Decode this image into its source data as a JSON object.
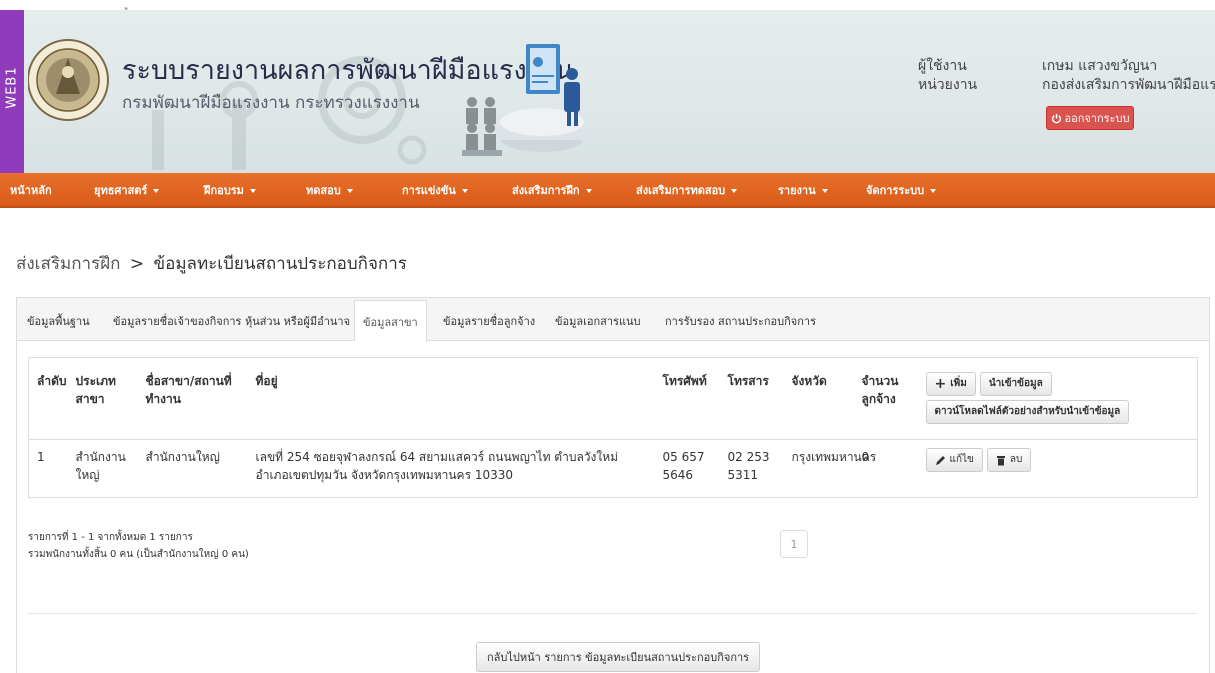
{
  "top_mark": "ู",
  "env_label": "WEB1",
  "header": {
    "title": "ระบบรายงานผลการพัฒนาฝีมือแรงงาน",
    "subtitle": "กรมพัฒนาฝีมือแรงงาน กระทรวงแรงงาน",
    "user_label": "ผู้ใช้งาน",
    "unit_label": "หน่วยงาน",
    "user_name": "เกษม แสวงขวัญนา",
    "user_unit": "กองส่งเสริมการพัฒนาฝีมือแรงงาน",
    "logout_label": "ออกจากระบบ"
  },
  "colors": {
    "nav_bg": "#e06524",
    "env_strip": "#8f3bbb",
    "logout_bg": "#d9534f",
    "header_bg": "#e0e8e9"
  },
  "nav": {
    "items": [
      {
        "label": "หน้าหลัก",
        "dropdown": false
      },
      {
        "label": "ยุทธศาสตร์",
        "dropdown": true
      },
      {
        "label": "ฝึกอบรม",
        "dropdown": true
      },
      {
        "label": "ทดสอบ",
        "dropdown": true
      },
      {
        "label": "การแข่งขัน",
        "dropdown": true
      },
      {
        "label": "ส่งเสริมการฝึก",
        "dropdown": true
      },
      {
        "label": "ส่งเสริมการทดสอบ",
        "dropdown": true
      },
      {
        "label": "รายงาน",
        "dropdown": true
      },
      {
        "label": "จัดการระบบ",
        "dropdown": true
      }
    ]
  },
  "breadcrumb": {
    "parent": "ส่งเสริมการฝึก",
    "separator": ">",
    "current": "ข้อมูลทะเบียนสถานประกอบกิจการ"
  },
  "tabs": [
    {
      "label": "ข้อมูลพื้นฐาน",
      "active": false
    },
    {
      "label": "ข้อมูลรายชื่อเจ้าของกิจการ หุ้นส่วน หรือผู้มีอำนาจ",
      "active": false
    },
    {
      "label": "ข้อมูลสาขา",
      "active": true
    },
    {
      "label": "ข้อมูลรายชื่อลูกจ้าง",
      "active": false
    },
    {
      "label": "ข้อมูลเอกสารแนบ",
      "active": false
    },
    {
      "label": "การรับรอง สถานประกอบกิจการ",
      "active": false
    }
  ],
  "table": {
    "headers": {
      "no": "ลำดับ",
      "type": "ประเภทสาขา",
      "name": "ชื่อสาขา/สถานที่ทำงาน",
      "address": "ที่อยู่",
      "phone": "โทรศัพท์",
      "fax": "โทรสาร",
      "province": "จังหวัด",
      "employees": "จำนวนลูกจ้าง"
    },
    "actions": {
      "add": "เพิ่ม",
      "import": "นำเข้าข้อมูล",
      "download_template": "ดาวน์โหลดไฟล์ตัวอย่างสำหรับนำเข้าข้อมูล",
      "edit": "แก้ไข",
      "delete": "ลบ"
    },
    "rows": [
      {
        "no": "1",
        "type": "สำนักงานใหญ่",
        "name": "สำนักงานใหญ่",
        "address": "เลขที่ 254 ซอยจุฬาลงกรณ์ 64 สยามแสควร์ ถนนพญาไท ตำบลวังใหม่ อำเภอเขตปทุมวัน จังหวัดกรุงเทพมหานคร 10330",
        "phone": "05 657 5646",
        "fax": "02 253 5311",
        "province": "กรุงเทพมหานคร",
        "employees": "0"
      }
    ]
  },
  "summary": {
    "records": "รายการที่ 1 - 1 จากทั้งหมด 1 รายการ",
    "employees": "รวมพนักงานทั้งสิ้น 0 คน (เป็นสำนักงานใหญ่ 0 คน)"
  },
  "pagination": {
    "current_page": "1"
  },
  "back_button": "กลับไปหน้า รายการ ข้อมูลทะเบียนสถานประกอบกิจการ"
}
